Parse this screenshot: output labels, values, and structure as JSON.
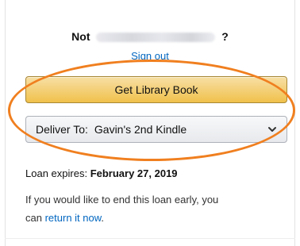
{
  "account": {
    "prefix": "Not",
    "suffix": "?",
    "sign_out_label": "Sign out"
  },
  "actions": {
    "get_library_book_label": "Get Library Book"
  },
  "deliver": {
    "label": "Deliver To:",
    "selected_device": "Gavin's 2nd Kindle"
  },
  "loan": {
    "expires_label": "Loan expires:",
    "expires_date": "February 27, 2019",
    "end_text_1": "If you would like to end this loan early, you",
    "end_text_2": "can",
    "return_link": "return it now",
    "end_text_3": "."
  },
  "colors": {
    "button_gold": "#f0c14b",
    "link_blue": "#0066c0",
    "highlight_orange": "#f07f1f"
  }
}
